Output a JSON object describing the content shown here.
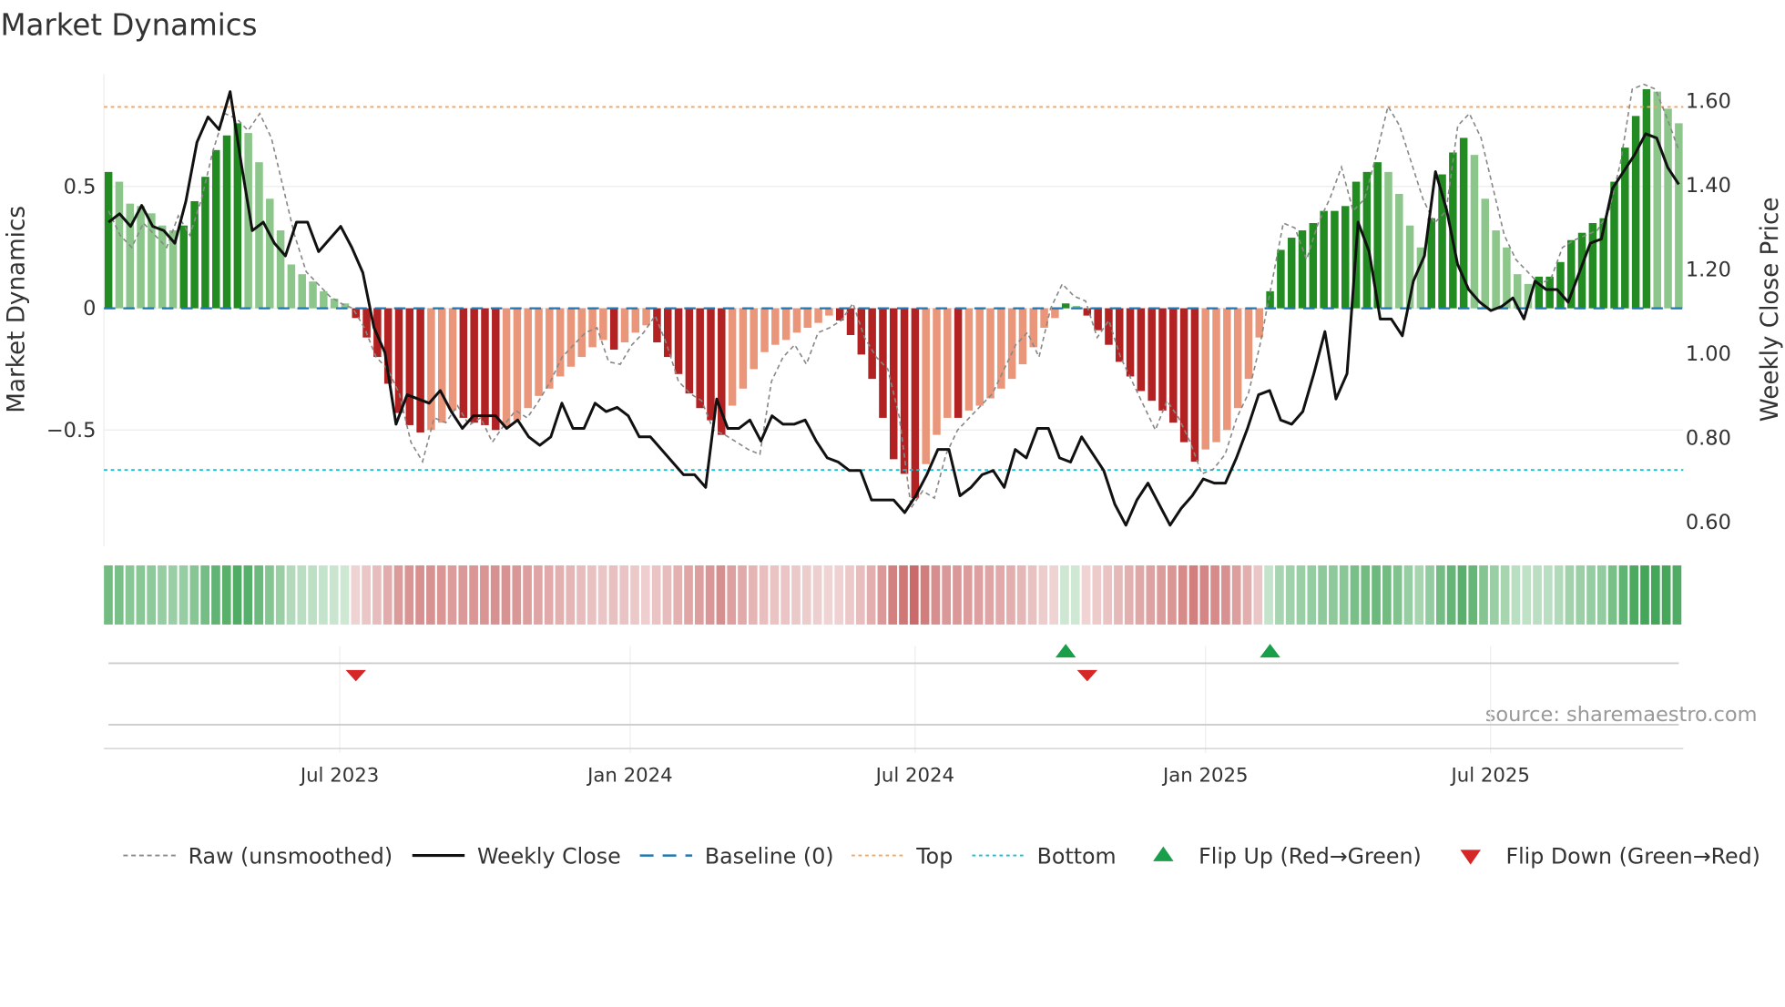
{
  "chart_data": {
    "type": "bar",
    "title": "Market Dynamics",
    "ylabel": "Market Dynamics",
    "y2label": "Weekly Close Price",
    "ylim": [
      -0.9,
      0.94
    ],
    "y2lim": [
      0.545,
      1.64
    ],
    "yticks": [
      {
        "v": 0.5,
        "label": "0.5"
      },
      {
        "v": 0,
        "label": "0"
      },
      {
        "v": -0.5,
        "label": "−0.5"
      }
    ],
    "y2ticks": [
      {
        "v": 1.6,
        "label": "1.60"
      },
      {
        "v": 1.4,
        "label": "1.40"
      },
      {
        "v": 1.2,
        "label": "1.20"
      },
      {
        "v": 1.0,
        "label": "1.00"
      },
      {
        "v": 0.8,
        "label": "0.80"
      },
      {
        "v": 0.6,
        "label": "0.60"
      }
    ],
    "xticks": [
      {
        "week": 21.5,
        "label": "Jul 2023"
      },
      {
        "week": 48.5,
        "label": "Jan 2024"
      },
      {
        "week": 75,
        "label": "Jul 2024"
      },
      {
        "week": 102,
        "label": "Jan 2025"
      },
      {
        "week": 128.5,
        "label": "Jul 2025"
      }
    ],
    "top_level": 0.827,
    "bottom_level": -0.664,
    "baseline": 0,
    "dynamics": [
      0.56,
      0.52,
      0.43,
      0.42,
      0.39,
      0.34,
      0.32,
      0.34,
      0.44,
      0.54,
      0.65,
      0.71,
      0.76,
      0.72,
      0.6,
      0.45,
      0.32,
      0.18,
      0.14,
      0.11,
      0.07,
      0.04,
      0.02,
      -0.04,
      -0.12,
      -0.2,
      -0.31,
      -0.43,
      -0.48,
      -0.51,
      -0.5,
      -0.47,
      -0.42,
      -0.45,
      -0.47,
      -0.48,
      -0.5,
      -0.49,
      -0.46,
      -0.41,
      -0.36,
      -0.33,
      -0.28,
      -0.24,
      -0.2,
      -0.16,
      -0.13,
      -0.17,
      -0.14,
      -0.1,
      -0.07,
      -0.14,
      -0.2,
      -0.27,
      -0.35,
      -0.41,
      -0.46,
      -0.52,
      -0.4,
      -0.33,
      -0.25,
      -0.18,
      -0.15,
      -0.13,
      -0.1,
      -0.08,
      -0.06,
      -0.03,
      -0.05,
      -0.11,
      -0.19,
      -0.29,
      -0.45,
      -0.62,
      -0.68,
      -0.78,
      -0.64,
      -0.52,
      -0.45,
      -0.45,
      -0.42,
      -0.4,
      -0.37,
      -0.33,
      -0.29,
      -0.23,
      -0.16,
      -0.08,
      -0.04,
      0.02,
      0.01,
      -0.03,
      -0.09,
      -0.15,
      -0.22,
      -0.28,
      -0.34,
      -0.38,
      -0.42,
      -0.47,
      -0.55,
      -0.63,
      -0.58,
      -0.55,
      -0.5,
      -0.41,
      -0.29,
      -0.12,
      0.07,
      0.24,
      0.29,
      0.32,
      0.35,
      0.4,
      0.4,
      0.42,
      0.52,
      0.56,
      0.6,
      0.56,
      0.47,
      0.34,
      0.25,
      0.37,
      0.55,
      0.64,
      0.7,
      0.63,
      0.45,
      0.32,
      0.25,
      0.14,
      0.1,
      0.13,
      0.13,
      0.19,
      0.28,
      0.31,
      0.35,
      0.37,
      0.52,
      0.66,
      0.79,
      0.9,
      0.89,
      0.82,
      0.76
    ],
    "raw": [
      0.4,
      0.3,
      0.25,
      0.35,
      0.3,
      0.25,
      0.38,
      0.3,
      0.45,
      0.65,
      0.8,
      0.78,
      0.73,
      0.8,
      0.7,
      0.5,
      0.3,
      0.15,
      0.1,
      0.05,
      0.02,
      0.0,
      -0.08,
      -0.2,
      -0.25,
      -0.35,
      -0.55,
      -0.63,
      -0.45,
      -0.47,
      -0.4,
      -0.48,
      -0.45,
      -0.55,
      -0.48,
      -0.42,
      -0.45,
      -0.38,
      -0.3,
      -0.2,
      -0.15,
      -0.1,
      -0.08,
      -0.22,
      -0.23,
      -0.15,
      -0.1,
      -0.03,
      -0.15,
      -0.3,
      -0.35,
      -0.38,
      -0.5,
      -0.52,
      -0.55,
      -0.58,
      -0.6,
      -0.3,
      -0.2,
      -0.15,
      -0.23,
      -0.1,
      -0.08,
      -0.05,
      0.02,
      -0.12,
      -0.2,
      -0.25,
      -0.45,
      -0.82,
      -0.75,
      -0.78,
      -0.6,
      -0.5,
      -0.45,
      -0.4,
      -0.35,
      -0.25,
      -0.15,
      -0.1,
      -0.2,
      0.0,
      0.1,
      0.05,
      0.03,
      -0.12,
      -0.05,
      -0.2,
      -0.3,
      -0.4,
      -0.5,
      -0.38,
      -0.45,
      -0.55,
      -0.68,
      -0.66,
      -0.6,
      -0.45,
      -0.35,
      -0.15,
      0.1,
      0.35,
      0.33,
      0.2,
      0.35,
      0.45,
      0.58,
      0.4,
      0.45,
      0.63,
      0.83,
      0.75,
      0.6,
      0.45,
      0.35,
      0.4,
      0.75,
      0.8,
      0.7,
      0.5,
      0.3,
      0.2,
      0.15,
      0.1,
      0.12,
      0.25,
      0.28,
      0.3,
      0.32,
      0.4,
      0.6,
      0.9,
      0.92,
      0.9,
      0.78,
      0.65
    ],
    "weekly_close": [
      1.31,
      1.33,
      1.3,
      1.35,
      1.3,
      1.29,
      1.26,
      1.36,
      1.5,
      1.56,
      1.53,
      1.62,
      1.45,
      1.29,
      1.31,
      1.26,
      1.23,
      1.31,
      1.31,
      1.24,
      1.27,
      1.3,
      1.25,
      1.19,
      1.06,
      1.0,
      0.83,
      0.9,
      0.89,
      0.88,
      0.91,
      0.86,
      0.82,
      0.85,
      0.85,
      0.85,
      0.82,
      0.84,
      0.8,
      0.78,
      0.8,
      0.88,
      0.82,
      0.82,
      0.88,
      0.86,
      0.87,
      0.85,
      0.8,
      0.8,
      0.77,
      0.74,
      0.71,
      0.71,
      0.68,
      0.89,
      0.82,
      0.82,
      0.84,
      0.79,
      0.85,
      0.83,
      0.83,
      0.84,
      0.79,
      0.75,
      0.74,
      0.72,
      0.72,
      0.65,
      0.65,
      0.65,
      0.62,
      0.66,
      0.71,
      0.77,
      0.77,
      0.66,
      0.68,
      0.71,
      0.72,
      0.68,
      0.77,
      0.75,
      0.82,
      0.82,
      0.75,
      0.74,
      0.8,
      0.76,
      0.72,
      0.64,
      0.59,
      0.65,
      0.69,
      0.64,
      0.59,
      0.63,
      0.66,
      0.7,
      0.69,
      0.69,
      0.75,
      0.82,
      0.9,
      0.91,
      0.84,
      0.83,
      0.86,
      0.95,
      1.05,
      0.89,
      0.95,
      1.31,
      1.24,
      1.08,
      1.08,
      1.04,
      1.17,
      1.23,
      1.43,
      1.34,
      1.21,
      1.15,
      1.12,
      1.1,
      1.11,
      1.13,
      1.08,
      1.17,
      1.15,
      1.15,
      1.12,
      1.19,
      1.26,
      1.27,
      1.39,
      1.43,
      1.47,
      1.52,
      1.51,
      1.44,
      1.4
    ],
    "flips": [
      {
        "week": 23,
        "type": "down"
      },
      {
        "week": 89,
        "type": "up"
      },
      {
        "week": 91,
        "type": "down"
      },
      {
        "week": 108,
        "type": "up"
      }
    ],
    "legend": [
      {
        "label": "Raw (unsmoothed)",
        "style": "raw"
      },
      {
        "label": "Weekly Close",
        "style": "close"
      },
      {
        "label": "Baseline (0)",
        "style": "baseline"
      },
      {
        "label": "Top",
        "style": "top"
      },
      {
        "label": "Bottom",
        "style": "bottom"
      },
      {
        "label": "Flip Up (Red→Green)",
        "style": "up"
      },
      {
        "label": "Flip Down (Green→Red)",
        "style": "down"
      }
    ],
    "legend_position": "bottom",
    "source": "source: sharemaestro.com",
    "colors": {
      "green_up": "#228b22",
      "green_down": "#8cc68b",
      "red_down": "#b22222",
      "red_up": "#e9967a",
      "close": "#111111",
      "raw": "#888888",
      "baseline": "#1f77b4",
      "top": "#f4a460",
      "bottom": "#17becf",
      "flip_up": "#1a9e4a",
      "flip_down": "#d62728"
    }
  }
}
